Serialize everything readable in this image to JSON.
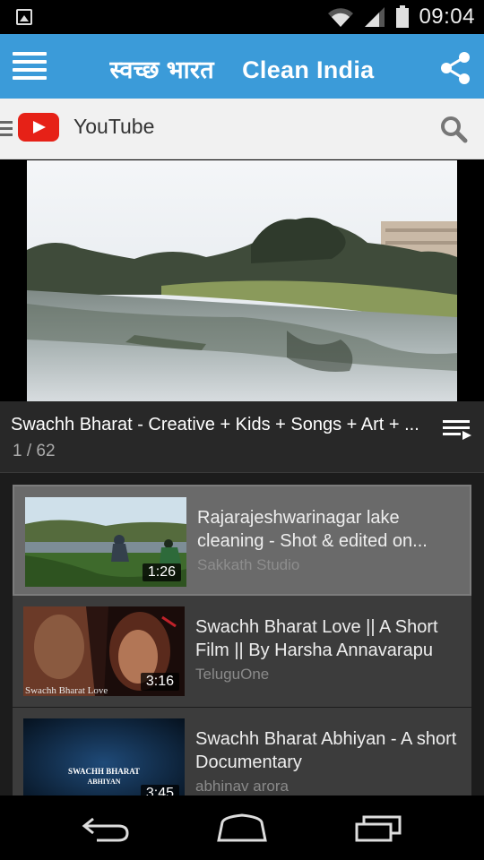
{
  "status": {
    "time": "09:04",
    "icons": [
      "image-notification-icon",
      "wifi-icon",
      "signal-icon",
      "battery-icon"
    ]
  },
  "appbar": {
    "title": "स्वच्छ भारत    Clean India",
    "background": "#3b9bd9",
    "icons": [
      "menu-icon",
      "share-icon"
    ]
  },
  "ytbar": {
    "label": "YouTube",
    "icons": [
      "hamburger-icon",
      "youtube-logo-icon",
      "search-icon"
    ],
    "logo_color": "#e62117"
  },
  "playlist": {
    "title": "Swachh Bharat - Creative + Kids + Songs + Art + ...",
    "count": "1 / 62"
  },
  "videos": [
    {
      "title": "Rajarajeshwarinagar lake cleaning - Shot & edited on...",
      "channel": "Sakkath Studio",
      "duration": "1:26",
      "active": true
    },
    {
      "title": "Swachh Bharat Love || A Short Film || By Harsha Annavarapu",
      "channel": "TeluguOne",
      "duration": "3:16",
      "thumb_text": "Swachh Bharat Love",
      "active": false
    },
    {
      "title": "Swachh Bharat Abhiyan - A short Documentary",
      "channel": "abhinav arora",
      "duration": "3:45",
      "thumb_text_1": "SWACHH BHARAT",
      "thumb_text_2": "ABHIYAN",
      "active": false
    }
  ],
  "navbar": {
    "icons": [
      "back-icon",
      "home-icon",
      "recents-icon"
    ]
  }
}
